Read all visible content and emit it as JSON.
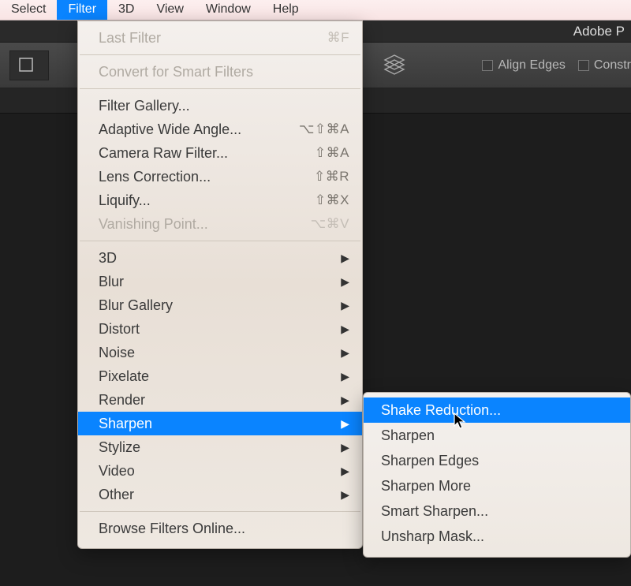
{
  "menubar": {
    "items": [
      "Select",
      "Filter",
      "3D",
      "View",
      "Window",
      "Help"
    ],
    "active_index": 1
  },
  "app_title": "Adobe P",
  "toolbar": {
    "align_edges_label": "Align Edges",
    "constr_label": "Constr"
  },
  "filter_menu": {
    "groups": [
      [
        {
          "label": "Last Filter",
          "shortcut": "⌘F",
          "disabled": true
        }
      ],
      [
        {
          "label": "Convert for Smart Filters",
          "disabled": true
        }
      ],
      [
        {
          "label": "Filter Gallery..."
        },
        {
          "label": "Adaptive Wide Angle...",
          "shortcut": "⌥⇧⌘A"
        },
        {
          "label": "Camera Raw Filter...",
          "shortcut": "⇧⌘A"
        },
        {
          "label": "Lens Correction...",
          "shortcut": "⇧⌘R"
        },
        {
          "label": "Liquify...",
          "shortcut": "⇧⌘X"
        },
        {
          "label": "Vanishing Point...",
          "shortcut": "⌥⌘V",
          "disabled": true
        }
      ],
      [
        {
          "label": "3D",
          "submenu": true
        },
        {
          "label": "Blur",
          "submenu": true
        },
        {
          "label": "Blur Gallery",
          "submenu": true
        },
        {
          "label": "Distort",
          "submenu": true
        },
        {
          "label": "Noise",
          "submenu": true
        },
        {
          "label": "Pixelate",
          "submenu": true
        },
        {
          "label": "Render",
          "submenu": true
        },
        {
          "label": "Sharpen",
          "submenu": true,
          "hovered": true
        },
        {
          "label": "Stylize",
          "submenu": true
        },
        {
          "label": "Video",
          "submenu": true
        },
        {
          "label": "Other",
          "submenu": true
        }
      ],
      [
        {
          "label": "Browse Filters Online..."
        }
      ]
    ]
  },
  "sharpen_submenu": {
    "items": [
      {
        "label": "Shake Reduction...",
        "hovered": true
      },
      {
        "label": "Sharpen"
      },
      {
        "label": "Sharpen Edges"
      },
      {
        "label": "Sharpen More"
      },
      {
        "label": "Smart Sharpen..."
      },
      {
        "label": "Unsharp Mask..."
      }
    ]
  }
}
